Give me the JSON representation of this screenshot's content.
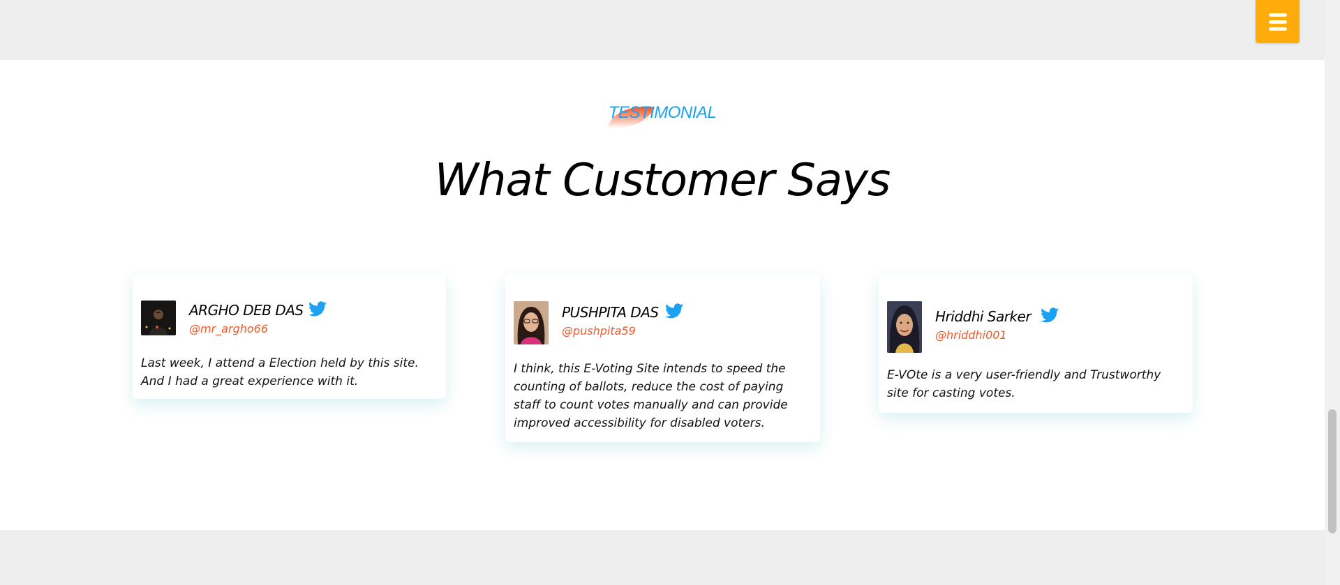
{
  "nav": {
    "menu_icon": "hamburger-menu-icon",
    "accent": "#ffac0b"
  },
  "section": {
    "eyebrow": "TESTIMONIAL",
    "title": "What Customer Says",
    "eyebrow_color": "#1aa1f0",
    "handle_color": "#f05a28",
    "twitter_color": "#1da1f2"
  },
  "testimonials": [
    {
      "name": "ARGHO DEB DAS",
      "handle": "@mr_argho66",
      "quote": "Last week, I attend a Election held by this site. And I had a great experience with it.",
      "icon": "twitter-icon"
    },
    {
      "name": "PUSHPITA DAS",
      "handle": "@pushpita59",
      "quote": "I think, this E-Voting Site intends to speed the counting of ballots, reduce the cost of paying staff to count votes manually and can provide improved accessibility for disabled voters.",
      "icon": "twitter-icon"
    },
    {
      "name": "Hriddhi Sarker",
      "handle": "@hriddhi001",
      "quote": "E-VOte is a very user-friendly and Trustworthy site for casting votes.",
      "icon": "twitter-icon"
    }
  ]
}
